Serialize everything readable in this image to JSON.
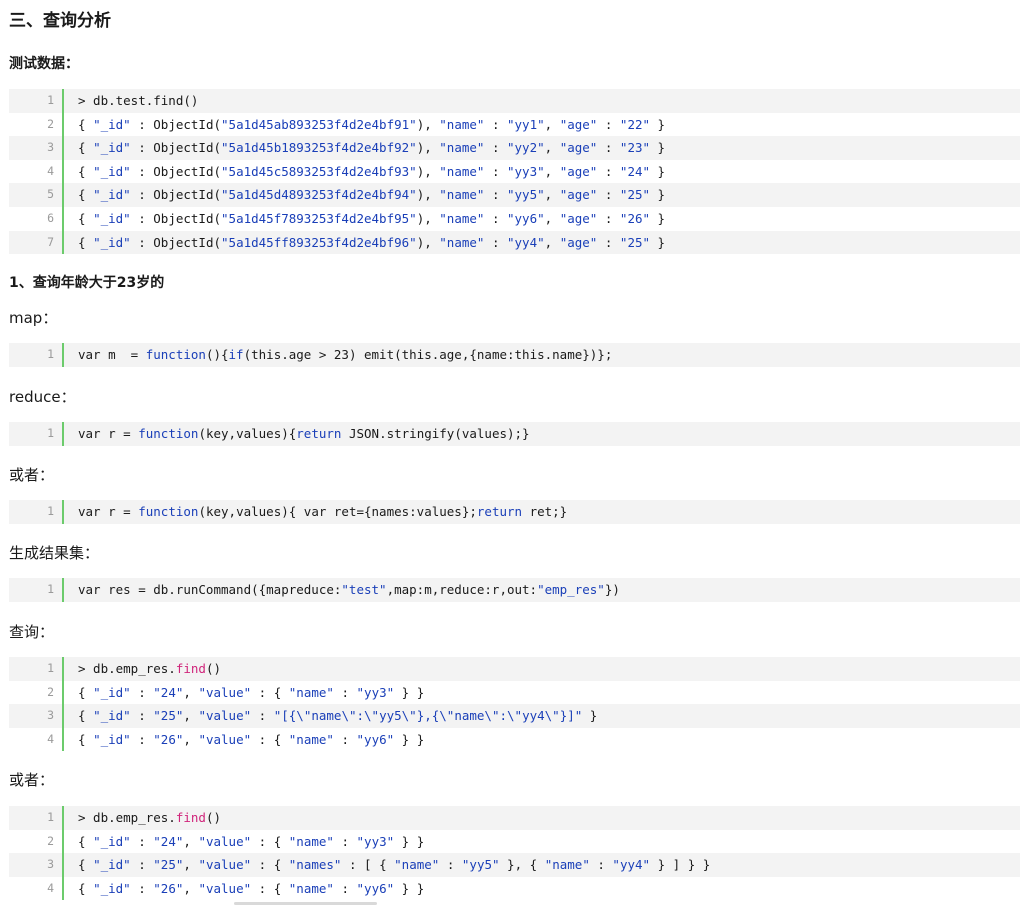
{
  "heading": "三、查询分析",
  "test_data_title": "测试数据：",
  "q1_title": "1、查询年龄大于23岁的",
  "labels": {
    "map": "map：",
    "reduce": "reduce：",
    "or1": "或者：",
    "result_set": "生成结果集：",
    "query": "查询：",
    "or2": "或者："
  },
  "blocks": {
    "test": [
      {
        "n": "1",
        "tokens": [
          [
            "",
            "> db.test.find()"
          ]
        ]
      },
      {
        "n": "2",
        "tokens": [
          [
            "",
            "{ "
          ],
          [
            "s",
            "\"_id\""
          ],
          [
            "",
            " : ObjectId("
          ],
          [
            "s",
            "\"5a1d45ab893253f4d2e4bf91\""
          ],
          [
            "",
            "), "
          ],
          [
            "s",
            "\"name\""
          ],
          [
            "",
            " : "
          ],
          [
            "s",
            "\"yy1\""
          ],
          [
            "",
            ", "
          ],
          [
            "s",
            "\"age\""
          ],
          [
            "",
            " : "
          ],
          [
            "s",
            "\"22\""
          ],
          [
            "",
            " }"
          ]
        ]
      },
      {
        "n": "3",
        "tokens": [
          [
            "",
            "{ "
          ],
          [
            "s",
            "\"_id\""
          ],
          [
            "",
            " : ObjectId("
          ],
          [
            "s",
            "\"5a1d45b1893253f4d2e4bf92\""
          ],
          [
            "",
            "), "
          ],
          [
            "s",
            "\"name\""
          ],
          [
            "",
            " : "
          ],
          [
            "s",
            "\"yy2\""
          ],
          [
            "",
            ", "
          ],
          [
            "s",
            "\"age\""
          ],
          [
            "",
            " : "
          ],
          [
            "s",
            "\"23\""
          ],
          [
            "",
            " }"
          ]
        ]
      },
      {
        "n": "4",
        "tokens": [
          [
            "",
            "{ "
          ],
          [
            "s",
            "\"_id\""
          ],
          [
            "",
            " : ObjectId("
          ],
          [
            "s",
            "\"5a1d45c5893253f4d2e4bf93\""
          ],
          [
            "",
            "), "
          ],
          [
            "s",
            "\"name\""
          ],
          [
            "",
            " : "
          ],
          [
            "s",
            "\"yy3\""
          ],
          [
            "",
            ", "
          ],
          [
            "s",
            "\"age\""
          ],
          [
            "",
            " : "
          ],
          [
            "s",
            "\"24\""
          ],
          [
            "",
            " }"
          ]
        ]
      },
      {
        "n": "5",
        "tokens": [
          [
            "",
            "{ "
          ],
          [
            "s",
            "\"_id\""
          ],
          [
            "",
            " : ObjectId("
          ],
          [
            "s",
            "\"5a1d45d4893253f4d2e4bf94\""
          ],
          [
            "",
            "), "
          ],
          [
            "s",
            "\"name\""
          ],
          [
            "",
            " : "
          ],
          [
            "s",
            "\"yy5\""
          ],
          [
            "",
            ", "
          ],
          [
            "s",
            "\"age\""
          ],
          [
            "",
            " : "
          ],
          [
            "s",
            "\"25\""
          ],
          [
            "",
            " }"
          ]
        ]
      },
      {
        "n": "6",
        "tokens": [
          [
            "",
            "{ "
          ],
          [
            "s",
            "\"_id\""
          ],
          [
            "",
            " : ObjectId("
          ],
          [
            "s",
            "\"5a1d45f7893253f4d2e4bf95\""
          ],
          [
            "",
            "), "
          ],
          [
            "s",
            "\"name\""
          ],
          [
            "",
            " : "
          ],
          [
            "s",
            "\"yy6\""
          ],
          [
            "",
            ", "
          ],
          [
            "s",
            "\"age\""
          ],
          [
            "",
            " : "
          ],
          [
            "s",
            "\"26\""
          ],
          [
            "",
            " }"
          ]
        ]
      },
      {
        "n": "7",
        "tokens": [
          [
            "",
            "{ "
          ],
          [
            "s",
            "\"_id\""
          ],
          [
            "",
            " : ObjectId("
          ],
          [
            "s",
            "\"5a1d45ff893253f4d2e4bf96\""
          ],
          [
            "",
            "), "
          ],
          [
            "s",
            "\"name\""
          ],
          [
            "",
            " : "
          ],
          [
            "s",
            "\"yy4\""
          ],
          [
            "",
            ", "
          ],
          [
            "s",
            "\"age\""
          ],
          [
            "",
            " : "
          ],
          [
            "s",
            "\"25\""
          ],
          [
            "",
            " }"
          ]
        ]
      }
    ],
    "map": [
      {
        "n": "1",
        "tokens": [
          [
            "",
            "var m  = "
          ],
          [
            "k",
            "function"
          ],
          [
            "",
            "(){"
          ],
          [
            "k",
            "if"
          ],
          [
            "",
            "(this.age > 23) emit(this.age,{name:this.name})};"
          ]
        ]
      }
    ],
    "reduce": [
      {
        "n": "1",
        "tokens": [
          [
            "",
            "var r = "
          ],
          [
            "k",
            "function"
          ],
          [
            "",
            "(key,values){"
          ],
          [
            "k",
            "return"
          ],
          [
            "",
            " JSON.stringify(values);}"
          ]
        ]
      }
    ],
    "reduce2": [
      {
        "n": "1",
        "tokens": [
          [
            "",
            "var r = "
          ],
          [
            "k",
            "function"
          ],
          [
            "",
            "(key,values){ var ret={names:values};"
          ],
          [
            "k",
            "return"
          ],
          [
            "",
            " ret;}"
          ]
        ]
      }
    ],
    "result": [
      {
        "n": "1",
        "tokens": [
          [
            "",
            "var res = db.runCommand({mapreduce:"
          ],
          [
            "s",
            "\"test\""
          ],
          [
            "",
            ",map:m,reduce:r,out:"
          ],
          [
            "s",
            "\"emp_res\""
          ],
          [
            "",
            "})"
          ]
        ]
      }
    ],
    "query1": [
      {
        "n": "1",
        "tokens": [
          [
            "",
            "> db.emp_res."
          ],
          [
            "f",
            "find"
          ],
          [
            "",
            "()"
          ]
        ]
      },
      {
        "n": "2",
        "tokens": [
          [
            "",
            "{ "
          ],
          [
            "s",
            "\"_id\""
          ],
          [
            "",
            " : "
          ],
          [
            "s",
            "\"24\""
          ],
          [
            "",
            ", "
          ],
          [
            "s",
            "\"value\""
          ],
          [
            "",
            " : { "
          ],
          [
            "s",
            "\"name\""
          ],
          [
            "",
            " : "
          ],
          [
            "s",
            "\"yy3\""
          ],
          [
            "",
            " } }"
          ]
        ]
      },
      {
        "n": "3",
        "tokens": [
          [
            "",
            "{ "
          ],
          [
            "s",
            "\"_id\""
          ],
          [
            "",
            " : "
          ],
          [
            "s",
            "\"25\""
          ],
          [
            "",
            ", "
          ],
          [
            "s",
            "\"value\""
          ],
          [
            "",
            " : "
          ],
          [
            "s",
            "\"[{\\\"name\\\":\\\"yy5\\\"},{\\\"name\\\":\\\"yy4\\\"}]\""
          ],
          [
            "",
            " }"
          ]
        ]
      },
      {
        "n": "4",
        "tokens": [
          [
            "",
            "{ "
          ],
          [
            "s",
            "\"_id\""
          ],
          [
            "",
            " : "
          ],
          [
            "s",
            "\"26\""
          ],
          [
            "",
            ", "
          ],
          [
            "s",
            "\"value\""
          ],
          [
            "",
            " : { "
          ],
          [
            "s",
            "\"name\""
          ],
          [
            "",
            " : "
          ],
          [
            "s",
            "\"yy6\""
          ],
          [
            "",
            " } }"
          ]
        ]
      }
    ],
    "query2": [
      {
        "n": "1",
        "tokens": [
          [
            "",
            "> db.emp_res."
          ],
          [
            "f",
            "find"
          ],
          [
            "",
            "()"
          ]
        ]
      },
      {
        "n": "2",
        "tokens": [
          [
            "",
            "{ "
          ],
          [
            "s",
            "\"_id\""
          ],
          [
            "",
            " : "
          ],
          [
            "s",
            "\"24\""
          ],
          [
            "",
            ", "
          ],
          [
            "s",
            "\"value\""
          ],
          [
            "",
            " : { "
          ],
          [
            "s",
            "\"name\""
          ],
          [
            "",
            " : "
          ],
          [
            "s",
            "\"yy3\""
          ],
          [
            "",
            " } }"
          ]
        ]
      },
      {
        "n": "3",
        "tokens": [
          [
            "",
            "{ "
          ],
          [
            "s",
            "\"_id\""
          ],
          [
            "",
            " : "
          ],
          [
            "s",
            "\"25\""
          ],
          [
            "",
            ", "
          ],
          [
            "s",
            "\"value\""
          ],
          [
            "",
            " : { "
          ],
          [
            "s",
            "\"names\""
          ],
          [
            "",
            " : [ { "
          ],
          [
            "s",
            "\"name\""
          ],
          [
            "",
            " : "
          ],
          [
            "s",
            "\"yy5\""
          ],
          [
            "",
            " }, { "
          ],
          [
            "s",
            "\"name\""
          ],
          [
            "",
            " : "
          ],
          [
            "s",
            "\"yy4\""
          ],
          [
            "",
            " } ] } }"
          ]
        ]
      },
      {
        "n": "4",
        "tokens": [
          [
            "",
            "{ "
          ],
          [
            "s",
            "\"_id\""
          ],
          [
            "",
            " : "
          ],
          [
            "s",
            "\"26\""
          ],
          [
            "",
            ", "
          ],
          [
            "s",
            "\"value\""
          ],
          [
            "",
            " : { "
          ],
          [
            "s",
            "\"name\""
          ],
          [
            "",
            " : "
          ],
          [
            "s",
            "\"yy6\""
          ],
          [
            "",
            " } }"
          ]
        ]
      }
    ]
  },
  "colors": {
    "string": "#1a3fb8",
    "keyword": "#1a3fb8",
    "func": "#d0257b",
    "gutter_border": "#6ccb6c",
    "alt_row": "#f3f3f3"
  }
}
